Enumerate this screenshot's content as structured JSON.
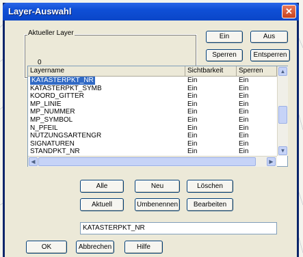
{
  "window": {
    "title": "Layer-Auswahl"
  },
  "current_layer": {
    "legend": "Aktueller Layer",
    "value": "0"
  },
  "top_buttons": {
    "on": "Ein",
    "off": "Aus",
    "lock": "Sperren",
    "unlock": "Entsperren"
  },
  "list": {
    "columns": [
      "Layername",
      "Sichtbarkeit",
      "Sperren"
    ],
    "rows": [
      {
        "name": "KATASTERPKT_NR",
        "visibility": "Ein",
        "lock": "Ein",
        "selected": true
      },
      {
        "name": "KATASTERPKT_SYMB",
        "visibility": "Ein",
        "lock": "Ein"
      },
      {
        "name": "KOORD_GITTER",
        "visibility": "Ein",
        "lock": "Ein"
      },
      {
        "name": "MP_LINIE",
        "visibility": "Ein",
        "lock": "Ein"
      },
      {
        "name": "MP_NUMMER",
        "visibility": "Ein",
        "lock": "Ein"
      },
      {
        "name": "MP_SYMBOL",
        "visibility": "Ein",
        "lock": "Ein"
      },
      {
        "name": "N_PFEIL",
        "visibility": "Ein",
        "lock": "Ein"
      },
      {
        "name": "NUTZUNGSARTENGR",
        "visibility": "Ein",
        "lock": "Ein"
      },
      {
        "name": "SIGNATUREN",
        "visibility": "Ein",
        "lock": "Ein"
      },
      {
        "name": "STANDPKT_NR",
        "visibility": "Ein",
        "lock": "Ein"
      }
    ]
  },
  "action_buttons": {
    "all": "Alle",
    "new": "Neu",
    "delete": "Löschen",
    "current": "Aktuell",
    "rename": "Umbenennen",
    "edit": "Bearbeiten"
  },
  "name_field": {
    "value": "KATASTERPKT_NR"
  },
  "bottom_buttons": {
    "ok": "OK",
    "cancel": "Abbrechen",
    "help": "Hilfe"
  },
  "colors": {
    "titlebar": "#0a46c8",
    "selection": "#316ac5",
    "face": "#ece9d8"
  }
}
